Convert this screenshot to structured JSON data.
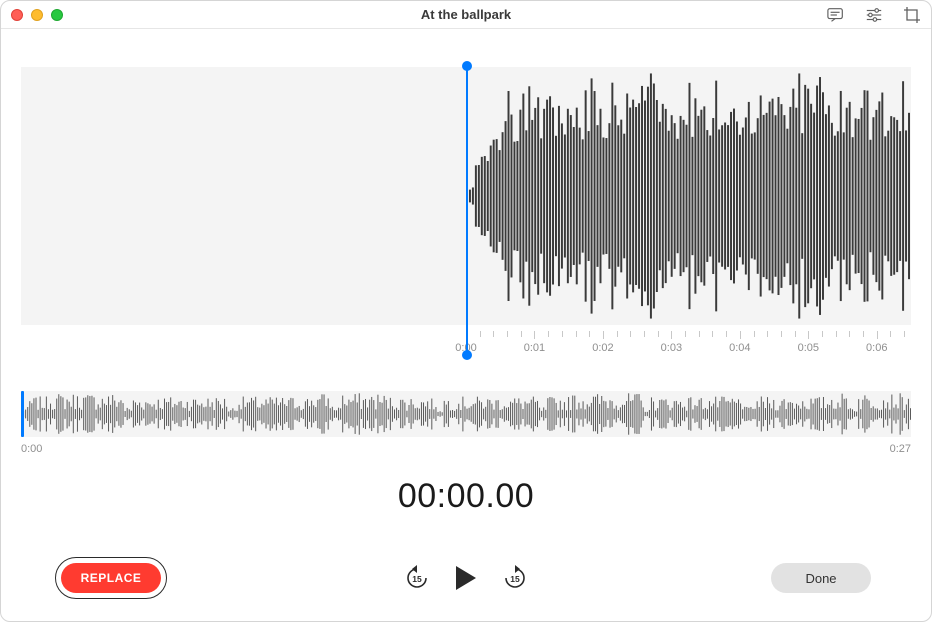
{
  "titlebar": {
    "title": "At the ballpark"
  },
  "icons": {
    "transcript": "transcript-icon",
    "settings": "sliders-icon",
    "trim": "crop-icon"
  },
  "detail_timeline": {
    "ticks": [
      "0:00",
      "0:01",
      "0:02",
      "0:03",
      "0:04",
      "0:05",
      "0:06"
    ]
  },
  "overview": {
    "start": "0:00",
    "end": "0:27"
  },
  "timer": {
    "display": "00:00.00"
  },
  "controls": {
    "replace_label": "REPLACE",
    "done_label": "Done",
    "skip_back_seconds": "15",
    "skip_forward_seconds": "15"
  },
  "colors": {
    "accent": "#007aff",
    "record": "#ff3b30"
  }
}
